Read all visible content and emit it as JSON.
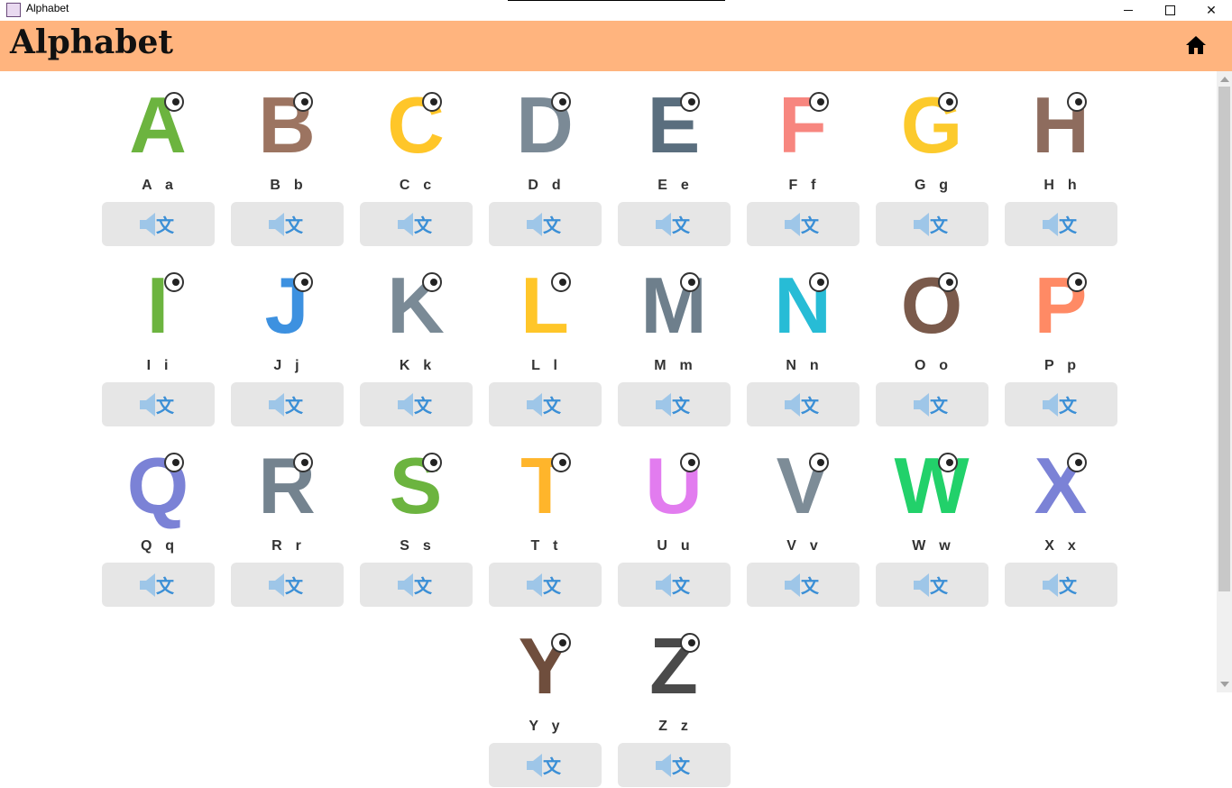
{
  "window": {
    "title": "Alphabet",
    "icon": "app-icon",
    "controls": {
      "minimize_icon": "minimize-icon",
      "maximize_icon": "maximize-icon",
      "close_glyph": "✕"
    }
  },
  "header": {
    "title": "Alphabet",
    "home_icon": "home-icon",
    "background": "#ffb47e"
  },
  "speak_button": {
    "icon": "speaker-translate-icon",
    "background": "#e6e6e6",
    "speaker_color": "#9ec6e8",
    "glyph_color": "#3b8fd6",
    "glyph": "文"
  },
  "letters": [
    {
      "label": "A  a",
      "animal": "alligator-icon",
      "color": "#6cb43f"
    },
    {
      "label": "B  b",
      "animal": "bear-icon",
      "color": "#9c7461"
    },
    {
      "label": "C  c",
      "animal": "cat-icon",
      "color": "#ffc629"
    },
    {
      "label": "D  d",
      "animal": "dog-icon",
      "color": "#7b8a96"
    },
    {
      "label": "E  e",
      "animal": "elephant-icon",
      "color": "#5a6e7e"
    },
    {
      "label": "F  f",
      "animal": "flamingo-icon",
      "color": "#f7867f"
    },
    {
      "label": "G  g",
      "animal": "giraffe-icon",
      "color": "#fcca2c"
    },
    {
      "label": "H  h",
      "animal": "horse-icon",
      "color": "#8e6c5e"
    },
    {
      "label": "I  i",
      "animal": "iguana-icon",
      "color": "#6cb43f"
    },
    {
      "label": "J  j",
      "animal": "jellyfish-icon",
      "color": "#3d91e0"
    },
    {
      "label": "K  k",
      "animal": "koala-icon",
      "color": "#7a8a96"
    },
    {
      "label": "L  l",
      "animal": "lion-icon",
      "color": "#ffc629"
    },
    {
      "label": "M  m",
      "animal": "monkey-icon",
      "color": "#6e7f8c"
    },
    {
      "label": "N  n",
      "animal": "narwhal-icon",
      "color": "#27bcd6"
    },
    {
      "label": "O  o",
      "animal": "owl-icon",
      "color": "#7a5a4b"
    },
    {
      "label": "P  p",
      "animal": "pig-icon",
      "color": "#ff8a65"
    },
    {
      "label": "Q  q",
      "animal": "quail-icon",
      "color": "#7b82d6"
    },
    {
      "label": "R  r",
      "animal": "rabbit-icon",
      "color": "#74838f"
    },
    {
      "label": "S  s",
      "animal": "snake-icon",
      "color": "#6cb43f"
    },
    {
      "label": "T  t",
      "animal": "tiger-icon",
      "color": "#ffb52b"
    },
    {
      "label": "U  u",
      "animal": "unicorn-icon",
      "color": "#e27cef"
    },
    {
      "label": "V  v",
      "animal": "vulture-icon",
      "color": "#7d8c97"
    },
    {
      "label": "W  w",
      "animal": "worm-icon",
      "color": "#22d16a"
    },
    {
      "label": "X  x",
      "animal": "xray-fish-icon",
      "color": "#7b82d6"
    },
    {
      "label": "Y  y",
      "animal": "yak-icon",
      "color": "#6f4e3d"
    },
    {
      "label": "Z  z",
      "animal": "zebra-icon",
      "color": "#4a4a4a"
    }
  ]
}
